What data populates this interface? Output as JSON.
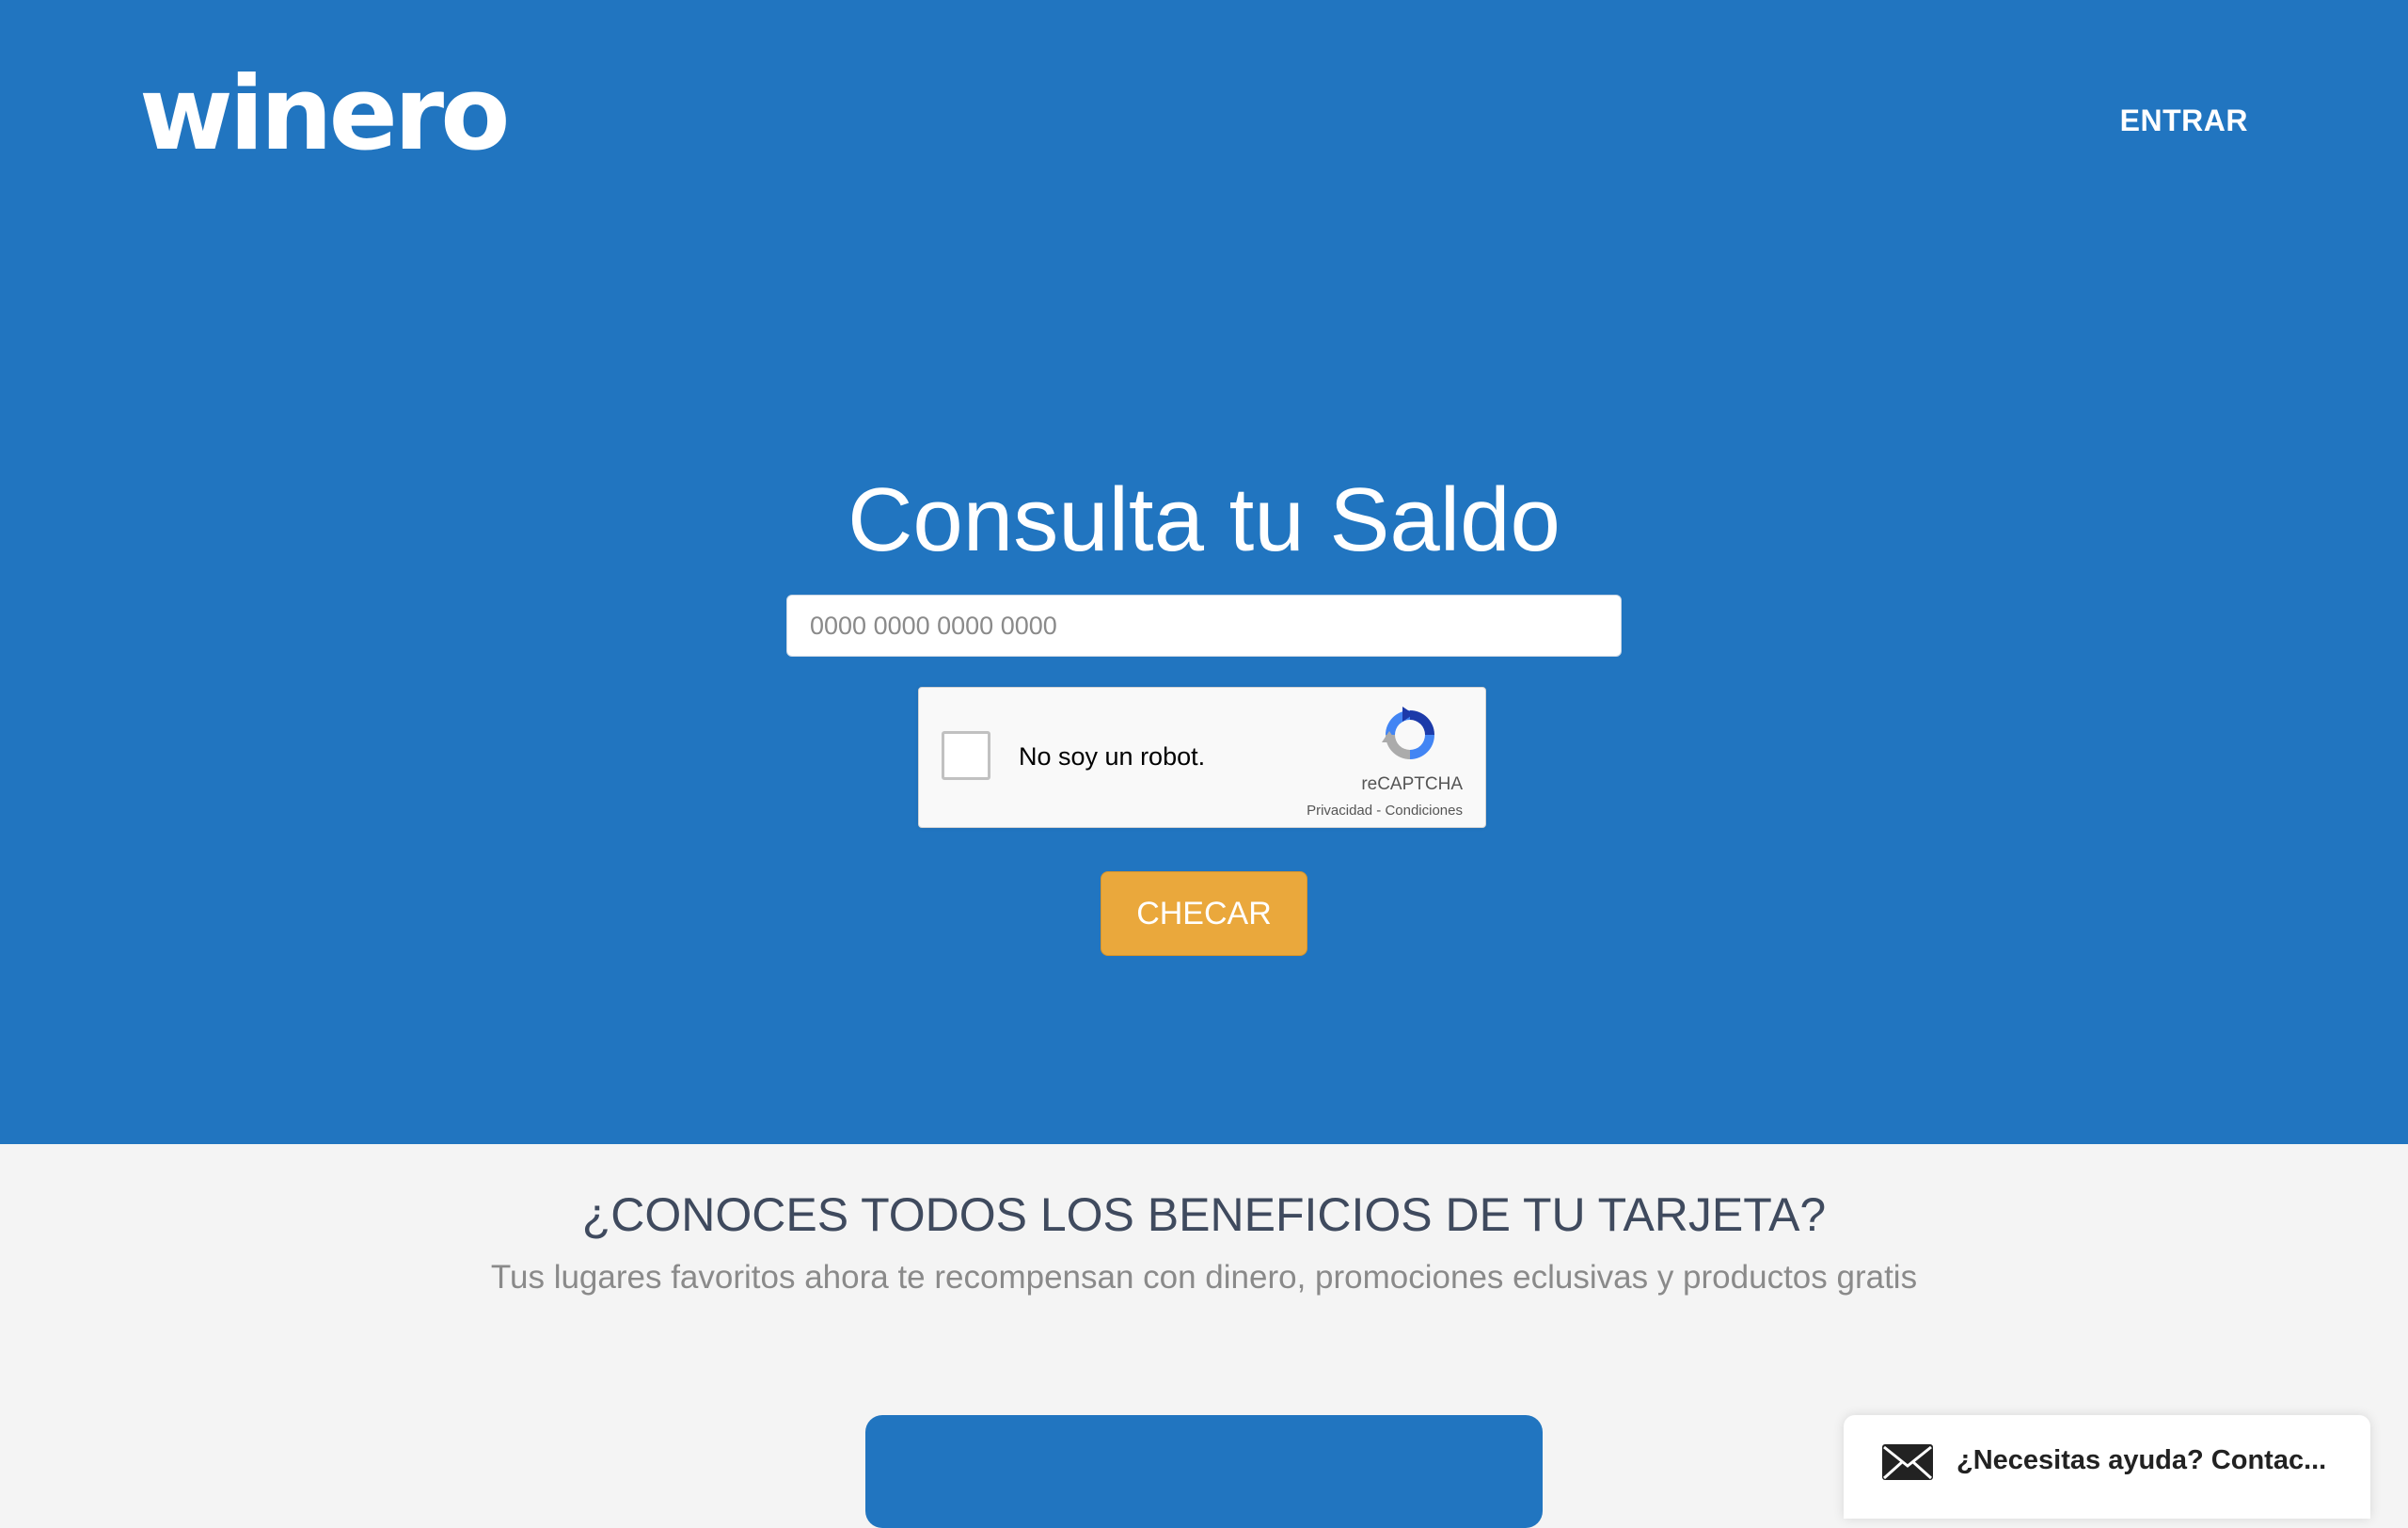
{
  "header": {
    "logo_text": "winero",
    "login_label": "ENTRAR"
  },
  "hero": {
    "title": "Consulta tu Saldo",
    "card_input": {
      "placeholder": "0000 0000 0000 0000",
      "value": ""
    },
    "captcha": {
      "label": "No soy un robot.",
      "brand": "reCAPTCHA",
      "links": "Privacidad - Condiciones",
      "checked": false
    },
    "submit_label": "CHECAR"
  },
  "benefits": {
    "title": "¿CONOCES TODOS LOS BENEFICIOS DE TU TARJETA?",
    "subtitle": "Tus lugares favoritos ahora te recompensan con dinero, promociones eclusivas y productos gratis"
  },
  "help_widget": {
    "text": "¿Necesitas ayuda? Contac...",
    "icon": "mail-icon"
  },
  "colors": {
    "primary_blue": "#2175c0",
    "accent_orange": "#eaa83c",
    "section_bg": "#f4f4f4"
  }
}
